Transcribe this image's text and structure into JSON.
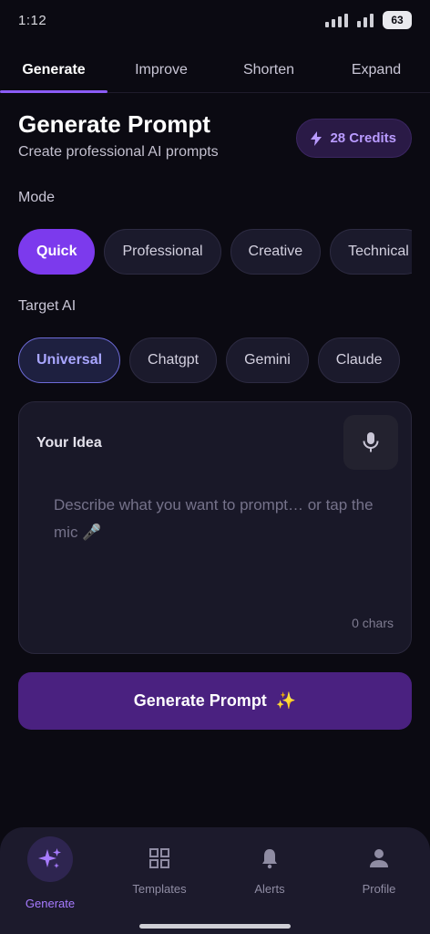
{
  "status": {
    "time": "1:12",
    "battery": "63"
  },
  "tabs": [
    {
      "label": "Generate",
      "active": true
    },
    {
      "label": "Improve"
    },
    {
      "label": "Shorten"
    },
    {
      "label": "Expand"
    }
  ],
  "header": {
    "title": "Generate Prompt",
    "subtitle": "Create professional AI prompts",
    "credits": "28 Credits"
  },
  "mode": {
    "label": "Mode",
    "options": [
      "Quick",
      "Professional",
      "Creative",
      "Technical"
    ],
    "selected": "Quick"
  },
  "target_ai": {
    "label": "Target AI",
    "options": [
      "Universal",
      "Chatgpt",
      "Gemini",
      "Claude"
    ],
    "selected": "Universal"
  },
  "idea": {
    "label": "Your Idea",
    "placeholder": "Describe what you want to prompt… or tap the mic 🎤",
    "char_count": "0 chars"
  },
  "generate_button": {
    "label": "Generate Prompt",
    "emoji": "✨"
  },
  "bottom_nav": [
    {
      "label": "Generate",
      "icon": "sparkles-icon",
      "active": true
    },
    {
      "label": "Templates",
      "icon": "grid-icon"
    },
    {
      "label": "Alerts",
      "icon": "bell-icon"
    },
    {
      "label": "Profile",
      "icon": "person-icon"
    }
  ],
  "colors": {
    "accent": "#7c3aed",
    "background": "#0b0a12",
    "credits_text": "#b99bff"
  }
}
